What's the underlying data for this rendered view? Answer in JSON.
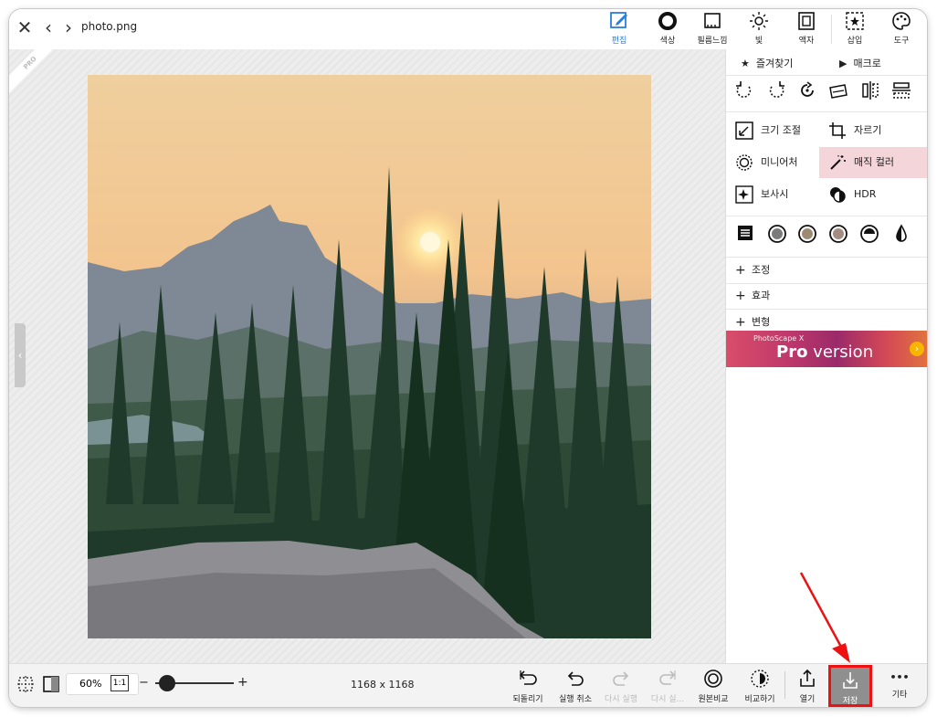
{
  "file": {
    "name": "photo.png"
  },
  "toolbar": {
    "tools": [
      {
        "label": "편집",
        "icon": "edit-icon",
        "active": true
      },
      {
        "label": "색상",
        "icon": "circle-icon"
      },
      {
        "label": "필름느낌",
        "icon": "film-icon"
      },
      {
        "label": "빛",
        "icon": "sun-icon"
      },
      {
        "label": "액자",
        "icon": "frame-icon"
      },
      {
        "label": "삽입",
        "icon": "insert-icon"
      },
      {
        "label": "도구",
        "icon": "palette-icon"
      }
    ]
  },
  "panel": {
    "favorites": "즐겨찾기",
    "macro": "매크로",
    "buttons": {
      "resize": "크기 조절",
      "crop": "자르기",
      "miniature": "미니어처",
      "magic_color": "매직 컬러",
      "correction": "보사시",
      "hdr": "HDR"
    },
    "accordions": [
      "조정",
      "효과",
      "변형"
    ],
    "banner": {
      "small": "PhotoScape X",
      "pro": "Pro",
      "version": "version"
    }
  },
  "canvas": {
    "ribbon": "PRO"
  },
  "bottom": {
    "zoom": "60%",
    "ratio": "1:1",
    "minus": "−",
    "plus": "+",
    "dimensions": "1168 x 1168",
    "actions": [
      {
        "label": "되돌리기",
        "disabled": false
      },
      {
        "label": "실행 취소",
        "disabled": false
      },
      {
        "label": "다시 실행",
        "disabled": true
      },
      {
        "label": "다시 실...",
        "disabled": true
      },
      {
        "label": "원본비교",
        "disabled": false
      },
      {
        "label": "비교하기",
        "disabled": false
      },
      {
        "label": "열기",
        "disabled": false
      },
      {
        "label": "저장",
        "disabled": false
      },
      {
        "label": "기타",
        "disabled": false
      }
    ],
    "more": "•••"
  },
  "colors": {
    "accent": "#2a7de1",
    "highlight": "#e11111",
    "magic": "#f4d5d9"
  }
}
